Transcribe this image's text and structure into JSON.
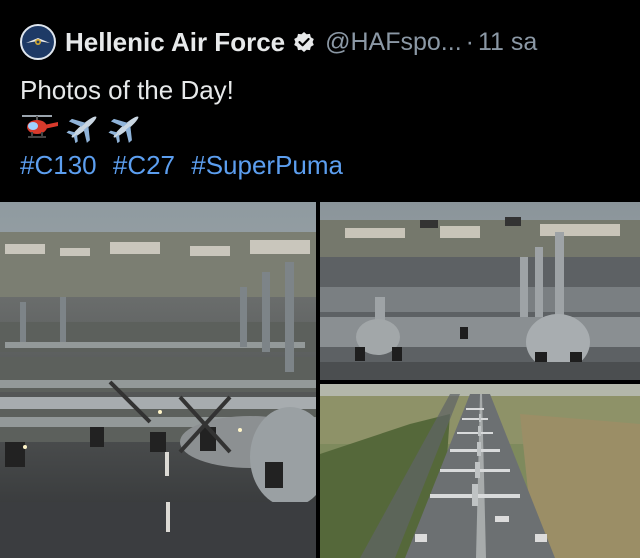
{
  "tweet": {
    "account_name": "Hellenic Air Force",
    "handle": "@HAFspo...",
    "separator": "·",
    "time": "11 sa",
    "text": "Photos of the Day!",
    "emojis": [
      "helicopter-emoji",
      "airplane-emoji",
      "airplane-emoji"
    ],
    "hashtags": [
      "#C130",
      "#C27",
      "#SuperPuma"
    ]
  },
  "colors": {
    "background": "#000000",
    "text": "#e7e9ea",
    "muted": "#8b98a5",
    "link": "#5c9eef",
    "verified": "#e7e9ea"
  }
}
